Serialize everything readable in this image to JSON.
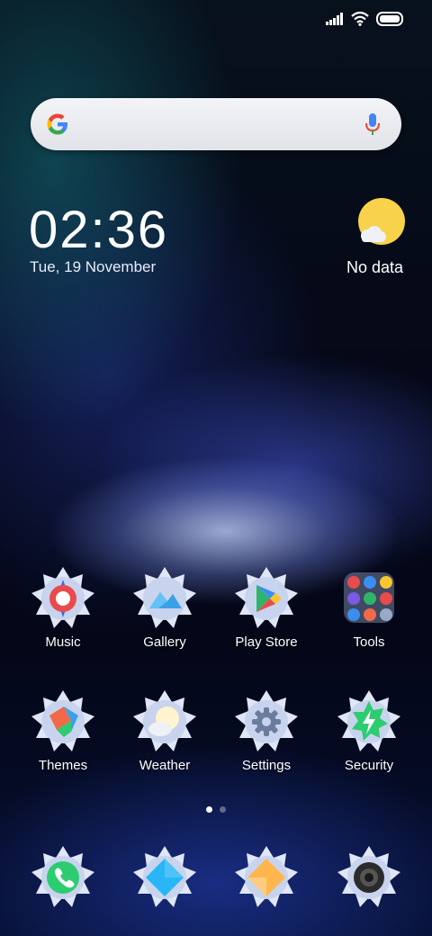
{
  "status_bar": {
    "icons": [
      "signal-icon",
      "wifi-icon",
      "battery-icon"
    ]
  },
  "search": {
    "logo": "google-logo",
    "mic": "mic-icon"
  },
  "clock": {
    "time": "02:36",
    "date": "Tue, 19 November"
  },
  "weather": {
    "icon": "partly-sunny-icon",
    "text": "No data"
  },
  "apps_row1": [
    {
      "label": "Music",
      "icon": "music-icon",
      "color": "#e84b4b"
    },
    {
      "label": "Gallery",
      "icon": "gallery-icon",
      "color": "#3aa0e8"
    },
    {
      "label": "Play Store",
      "icon": "play-store-icon",
      "color": "#2fb46a"
    },
    {
      "label": "Tools",
      "icon": "tools-folder-icon",
      "color": "#6a8ee0"
    }
  ],
  "apps_row2": [
    {
      "label": "Themes",
      "icon": "themes-icon",
      "color": "#f06a4a"
    },
    {
      "label": "Weather",
      "icon": "weather-app-icon",
      "color": "#f4d58a"
    },
    {
      "label": "Settings",
      "icon": "settings-icon",
      "color": "#6b7c9c"
    },
    {
      "label": "Security",
      "icon": "security-icon",
      "color": "#2ecc71"
    }
  ],
  "page_indicator": {
    "count": 2,
    "active": 1
  },
  "dock": [
    {
      "icon": "phone-icon",
      "color": "#2ecc71"
    },
    {
      "icon": "messages-icon",
      "color": "#29b6f6"
    },
    {
      "icon": "browser-icon",
      "color": "#ffb74d"
    },
    {
      "icon": "camera-icon",
      "color": "#333333"
    }
  ]
}
